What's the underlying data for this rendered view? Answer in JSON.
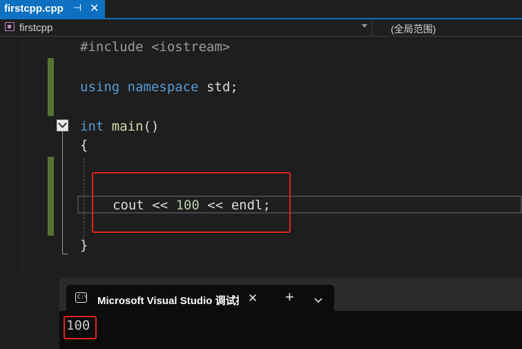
{
  "tab": {
    "filename": "firstcpp.cpp",
    "pin_glyph": "⊣",
    "close_glyph": "✕"
  },
  "navbar": {
    "project": "firstcpp",
    "scope": "(全局范围)"
  },
  "code": {
    "line1": {
      "directive": "#include",
      "header": "<iostream>"
    },
    "line2": {
      "kw_using": "using",
      "kw_namespace": "namespace",
      "rest": "std;"
    },
    "line3": {
      "kw_int": "int",
      "func": "main",
      "parens": "()"
    },
    "open_brace": "{",
    "line5": {
      "ident": "cout",
      "op1": "<<",
      "number": "100",
      "op2": "<<",
      "endl": "endl;"
    },
    "close_brace": "}"
  },
  "terminal": {
    "icon_text": "C:\\",
    "title": "Microsoft Visual Studio 调试控制台",
    "close_glyph": "✕",
    "new_tab_glyph": "+",
    "output": "100"
  },
  "colors": {
    "accent_tab": "#0e70c0",
    "highlight_box": "#e52420",
    "keyword": "#569cd6",
    "function": "#dcdcaa",
    "number": "#b5cea8",
    "change_bar": "#557530"
  }
}
